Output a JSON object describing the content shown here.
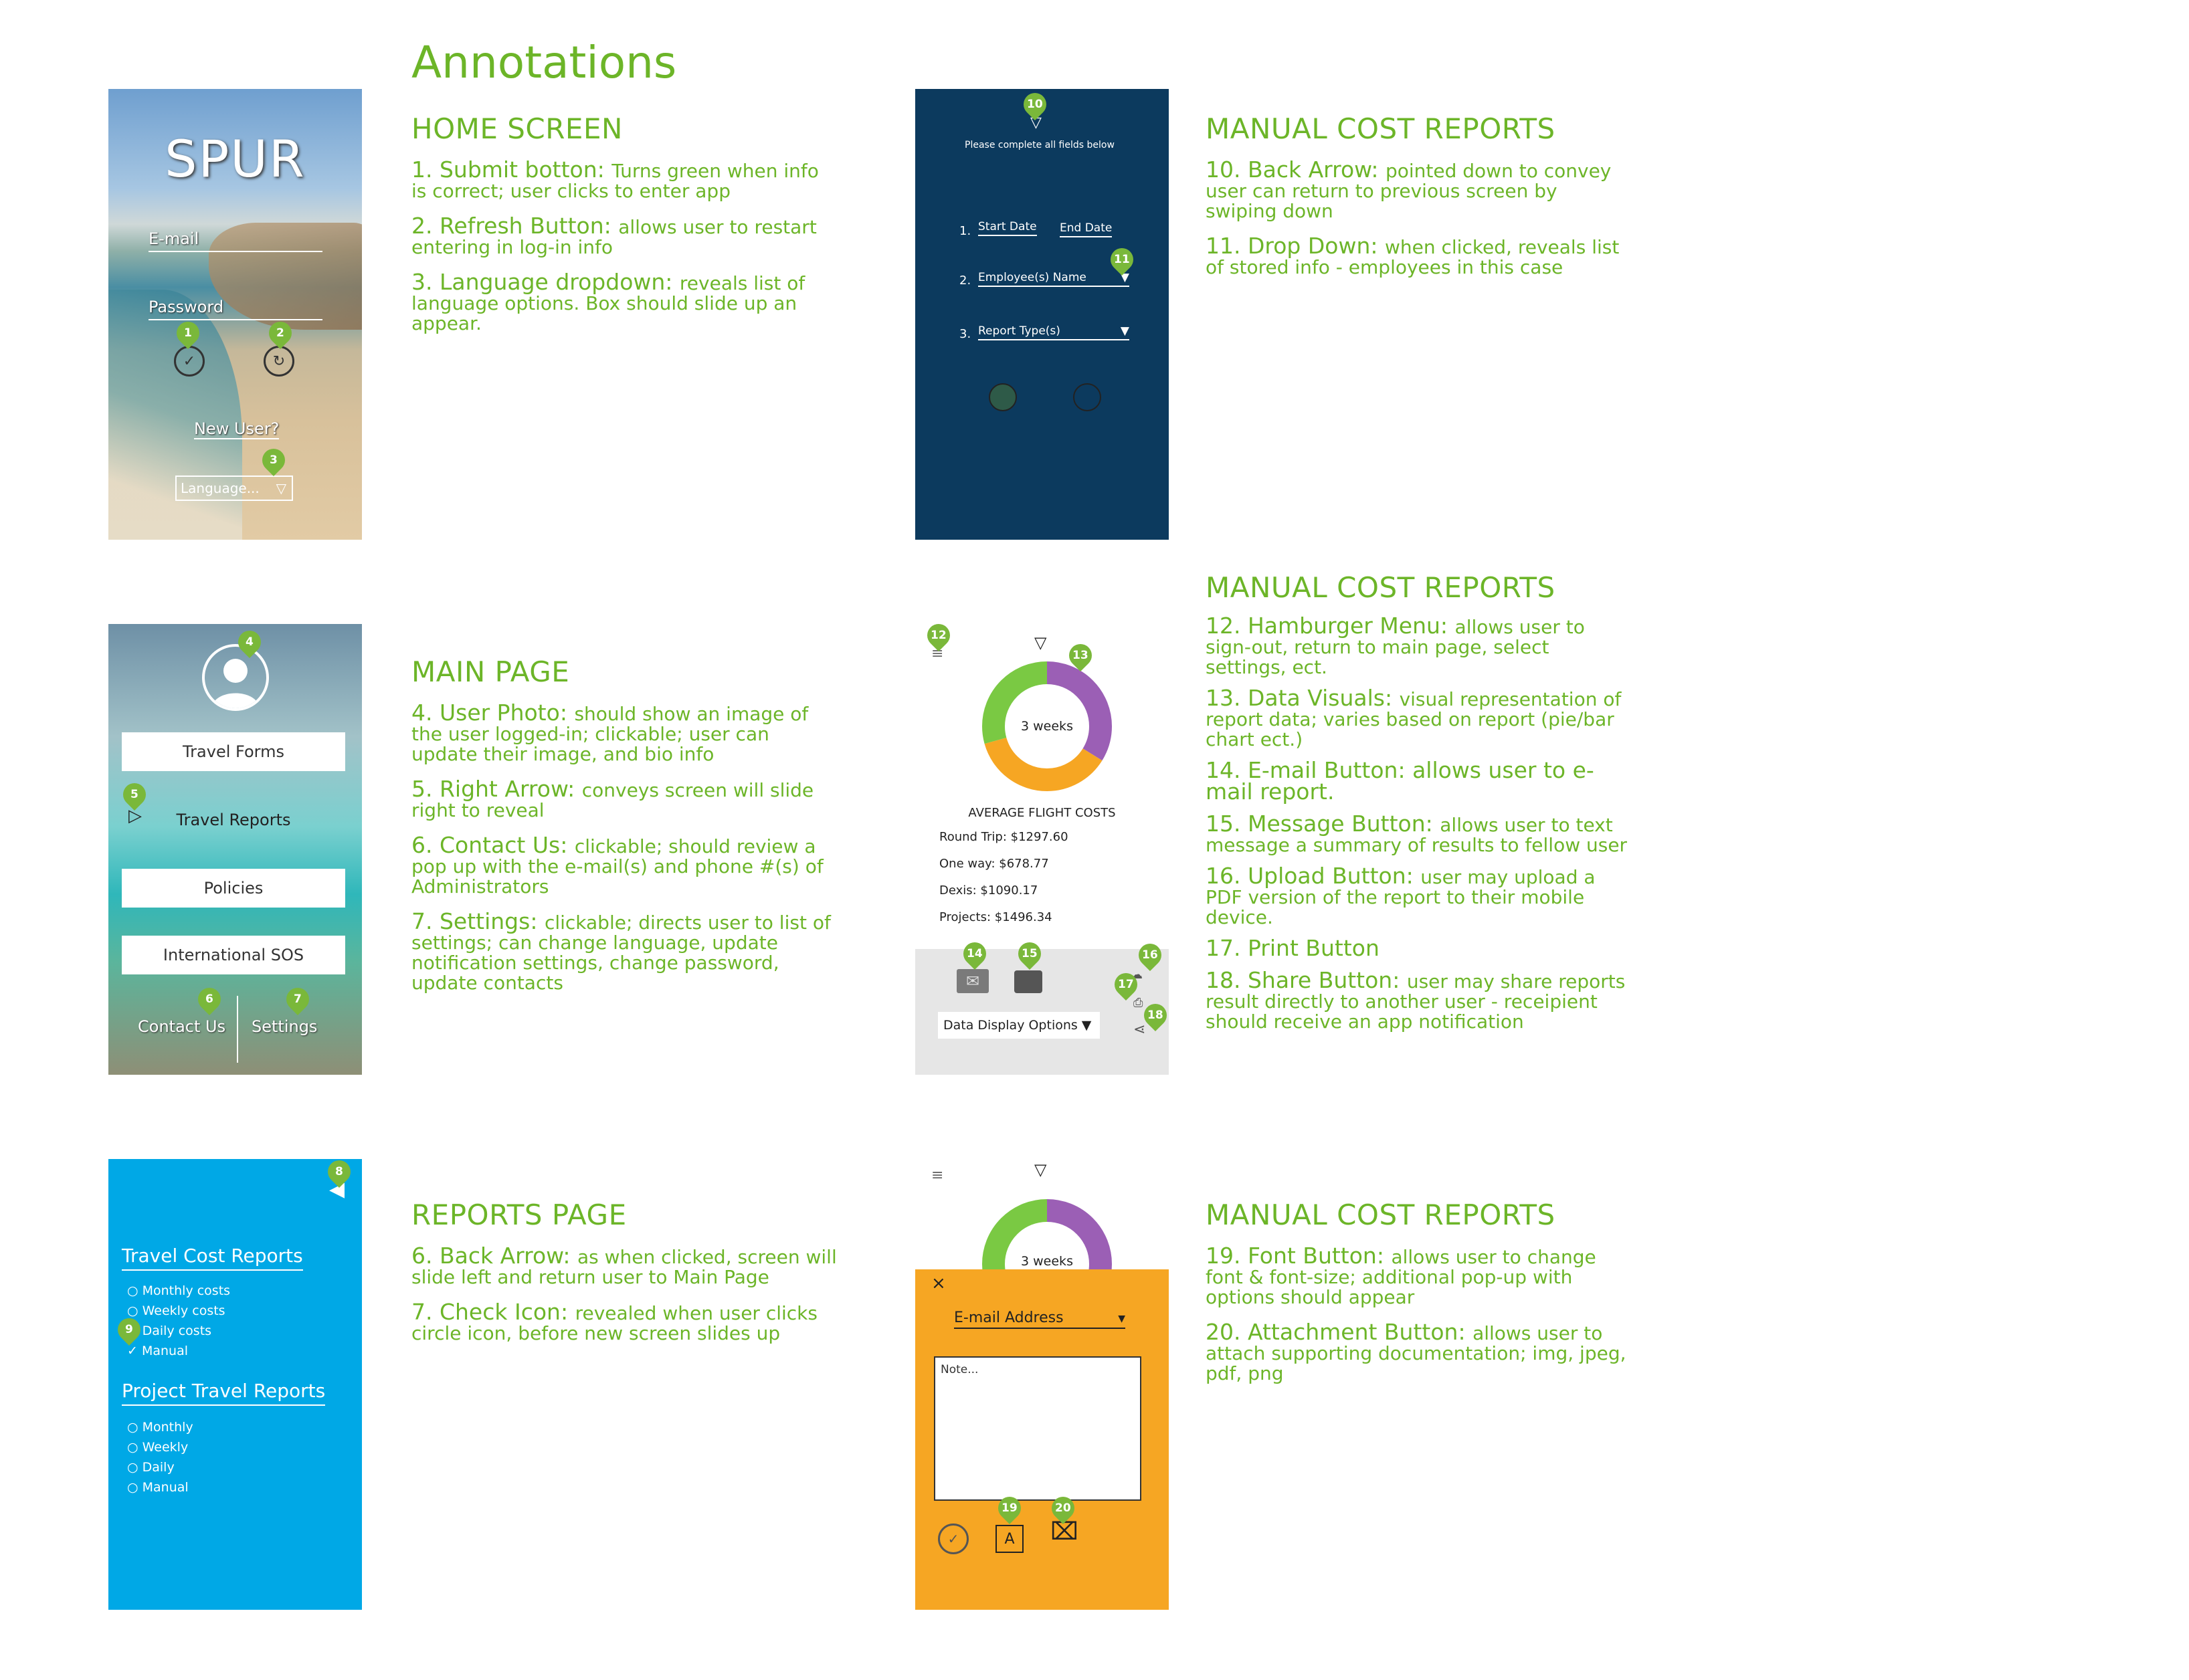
{
  "page_title": "Annotations",
  "home": {
    "logo": "SPUR",
    "email_label": "E-mail",
    "password_label": "Password",
    "new_user": "New User?",
    "language_placeholder": "Language..."
  },
  "manual_form": {
    "instruction": "Please complete all fields below",
    "row1_num": "1.",
    "start_date": "Start Date",
    "end_date": "End Date",
    "row2_num": "2.",
    "employee": "Employee(s) Name",
    "row3_num": "3.",
    "report_type": "Report Type(s)"
  },
  "main_page": {
    "items": [
      "Travel Forms",
      "Travel Reports",
      "Policies",
      "International SOS"
    ],
    "contact": "Contact Us",
    "settings": "Settings"
  },
  "reports_page": {
    "travel_heading": "Travel Cost Reports",
    "travel_items": [
      "Monthly costs",
      "Weekly costs",
      "Daily costs",
      "Manual"
    ],
    "project_heading": "Project Travel Reports",
    "project_items": [
      "Monthly",
      "Weekly",
      "Daily",
      "Manual"
    ]
  },
  "visuals": {
    "donut_label": "3 weeks",
    "chart_title": "AVERAGE FLIGHT COSTS",
    "stats": [
      "Round Trip:  $1297.60",
      "One way:  $678.77",
      "Dexis:  $1090.17",
      "Projects:  $1496.34"
    ],
    "display_options": "Data Display Options",
    "colors": {
      "green": "#7ac943",
      "purple": "#9b5fb5",
      "orange": "#f6a623"
    }
  },
  "email_sheet": {
    "donut_label": "3 weeks",
    "close": "×",
    "email_address": "E-mail Address",
    "note_placeholder": "Note...",
    "font_letter": "A"
  },
  "sections": {
    "home": {
      "heading": "HOME SCREEN",
      "notes": [
        {
          "lead": "1. Submit botton: ",
          "text": "Turns green when info is correct; user clicks to enter app"
        },
        {
          "lead": "2. Refresh Button: ",
          "text": "allows user to restart entering in log-in info"
        },
        {
          "lead": "3. Language dropdown: ",
          "text": "reveals list of language options. Box should slide up an appear."
        }
      ]
    },
    "manual1": {
      "heading": "MANUAL COST REPORTS",
      "notes": [
        {
          "lead": "10. Back Arrow: ",
          "text": "pointed down to convey user can return to previous screen by swiping down"
        },
        {
          "lead": "11. Drop Down: ",
          "text": "when clicked, reveals list of stored info - employees in this case"
        }
      ]
    },
    "main": {
      "heading": "MAIN PAGE",
      "notes": [
        {
          "lead": "4. User Photo: ",
          "text": "should show an image of the user logged-in; clickable; user can update their image, and bio info"
        },
        {
          "lead": "5. Right Arrow: ",
          "text": "conveys screen will slide right to reveal"
        },
        {
          "lead": "6. Contact Us: ",
          "text": "clickable; should review a pop up with the e-mail(s) and phone #(s) of Administrators"
        },
        {
          "lead": "7. Settings: ",
          "text": "clickable; directs user to list of settings; can change language, update notification settings, change password, update contacts"
        }
      ]
    },
    "manual2": {
      "heading": "MANUAL COST REPORTS",
      "notes": [
        {
          "lead": "12. Hamburger Menu: ",
          "text": "allows user to sign-out, return to main page, select settings, ect."
        },
        {
          "lead": "13. Data Visuals: ",
          "text": "visual representation of report data; varies based on report (pie/bar chart ect.)"
        },
        {
          "lead": "14. E-mail Button: allows user to e-mail report.",
          "text": ""
        },
        {
          "lead": "15. Message Button: ",
          "text": "allows user to text message a summary of results to fellow user"
        },
        {
          "lead": "16. Upload Button: ",
          "text": "user may upload a PDF version of the report to their mobile device."
        },
        {
          "lead": "17. Print Button",
          "text": ""
        },
        {
          "lead": "18. Share Button: ",
          "text": "user may share reports result directly to another user - receipient should receive an app notification"
        }
      ]
    },
    "reports": {
      "heading": "REPORTS PAGE",
      "notes": [
        {
          "lead": "6. Back Arrow: ",
          "text": "as when clicked, screen will slide left and return user to Main Page"
        },
        {
          "lead": "7. Check Icon: ",
          "text": "revealed when user clicks circle icon, before new screen slides up"
        }
      ]
    },
    "manual3": {
      "heading": "MANUAL COST REPORTS",
      "notes": [
        {
          "lead": "19. Font Button: ",
          "text": "allows user to change font & font-size; additional pop-up with options should appear"
        },
        {
          "lead": "20. Attachment Button: ",
          "text": "allows user to attach supporting documentation; img, jpeg, pdf, png"
        }
      ]
    }
  },
  "pins": [
    "1",
    "2",
    "3",
    "4",
    "5",
    "6",
    "7",
    "8",
    "9",
    "10",
    "11",
    "12",
    "13",
    "14",
    "15",
    "16",
    "17",
    "18",
    "19",
    "20"
  ]
}
